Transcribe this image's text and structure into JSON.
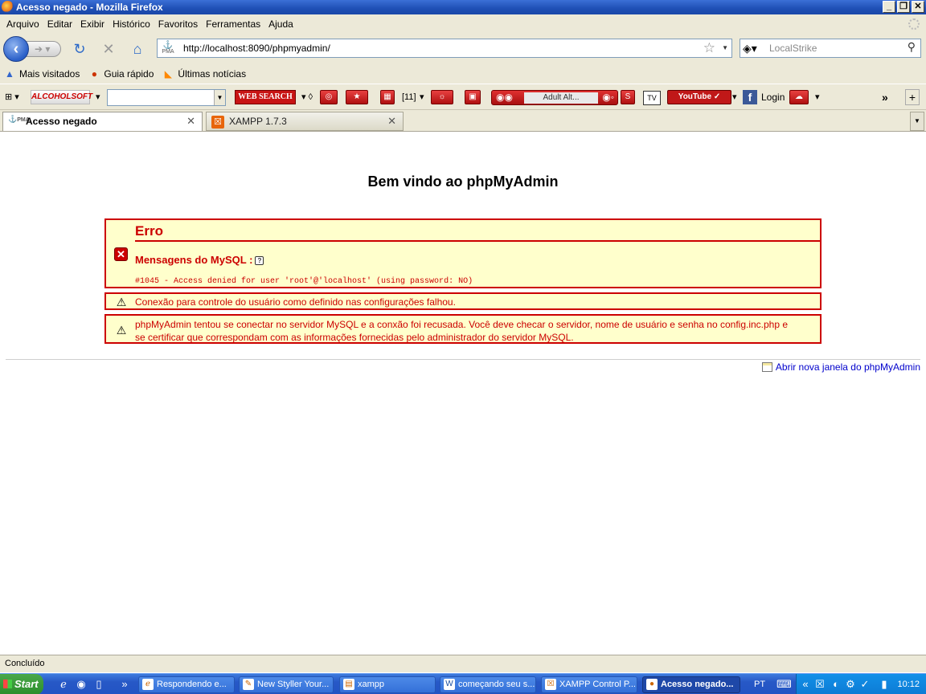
{
  "window": {
    "title": "Acesso negado - Mozilla Firefox"
  },
  "menu": [
    "Arquivo",
    "Editar",
    "Exibir",
    "Histórico",
    "Favoritos",
    "Ferramentas",
    "Ajuda"
  ],
  "nav": {
    "url": "http://localhost:8090/phpmyadmin/",
    "search_placeholder": "LocalStrike"
  },
  "bookmarks": [
    "Mais visitados",
    "Guia rápido",
    "Últimas notícias"
  ],
  "toolbar": {
    "alcohol_label": "ALCOHOLSOFT",
    "web_search_label": "WEB SEARCH",
    "counter": "[11]",
    "player_label": "Adult Alt...",
    "youtube_label": "YouTube",
    "login_label": "Login",
    "overflow": "»"
  },
  "tabs": [
    {
      "label": "Acesso negado",
      "active": true
    },
    {
      "label": "XAMPP 1.7.3",
      "active": false
    }
  ],
  "page": {
    "welcome": "Bem vindo ao phpMyAdmin",
    "error_title": "Erro",
    "mysql_messages": "Mensagens do MySQL :",
    "error_code": "#1045 - Access denied for user 'root'@'localhost' (using password: NO)",
    "warning1": "Conexão para controle do usuário como definido nas configurações falhou.",
    "warning2": "phpMyAdmin tentou se conectar no servidor MySQL e a conxão foi recusada. Você deve checar o servidor, nome de usuário e senha no config.inc.php e se certificar que correspondam com as informações fornecidas pelo administrador do servidor MySQL.",
    "new_window_link": "Abrir nova janela do phpMyAdmin"
  },
  "status": "Concluído",
  "taskbar": {
    "start": "Start",
    "tasks": [
      {
        "label": "Respondendo e...",
        "active": false
      },
      {
        "label": "New Styller Your...",
        "active": false
      },
      {
        "label": "xampp",
        "active": false
      },
      {
        "label": "começando seu s...",
        "active": false
      },
      {
        "label": "XAMPP Control P...",
        "active": false
      },
      {
        "label": "Acesso negado...",
        "active": true
      }
    ],
    "language": "PT",
    "clock": "10:12"
  },
  "colors": {
    "error_red": "#cc0000",
    "error_bg": "#ffffcc",
    "link_blue": "#0000cc",
    "xp_blue": "#2254c4"
  }
}
